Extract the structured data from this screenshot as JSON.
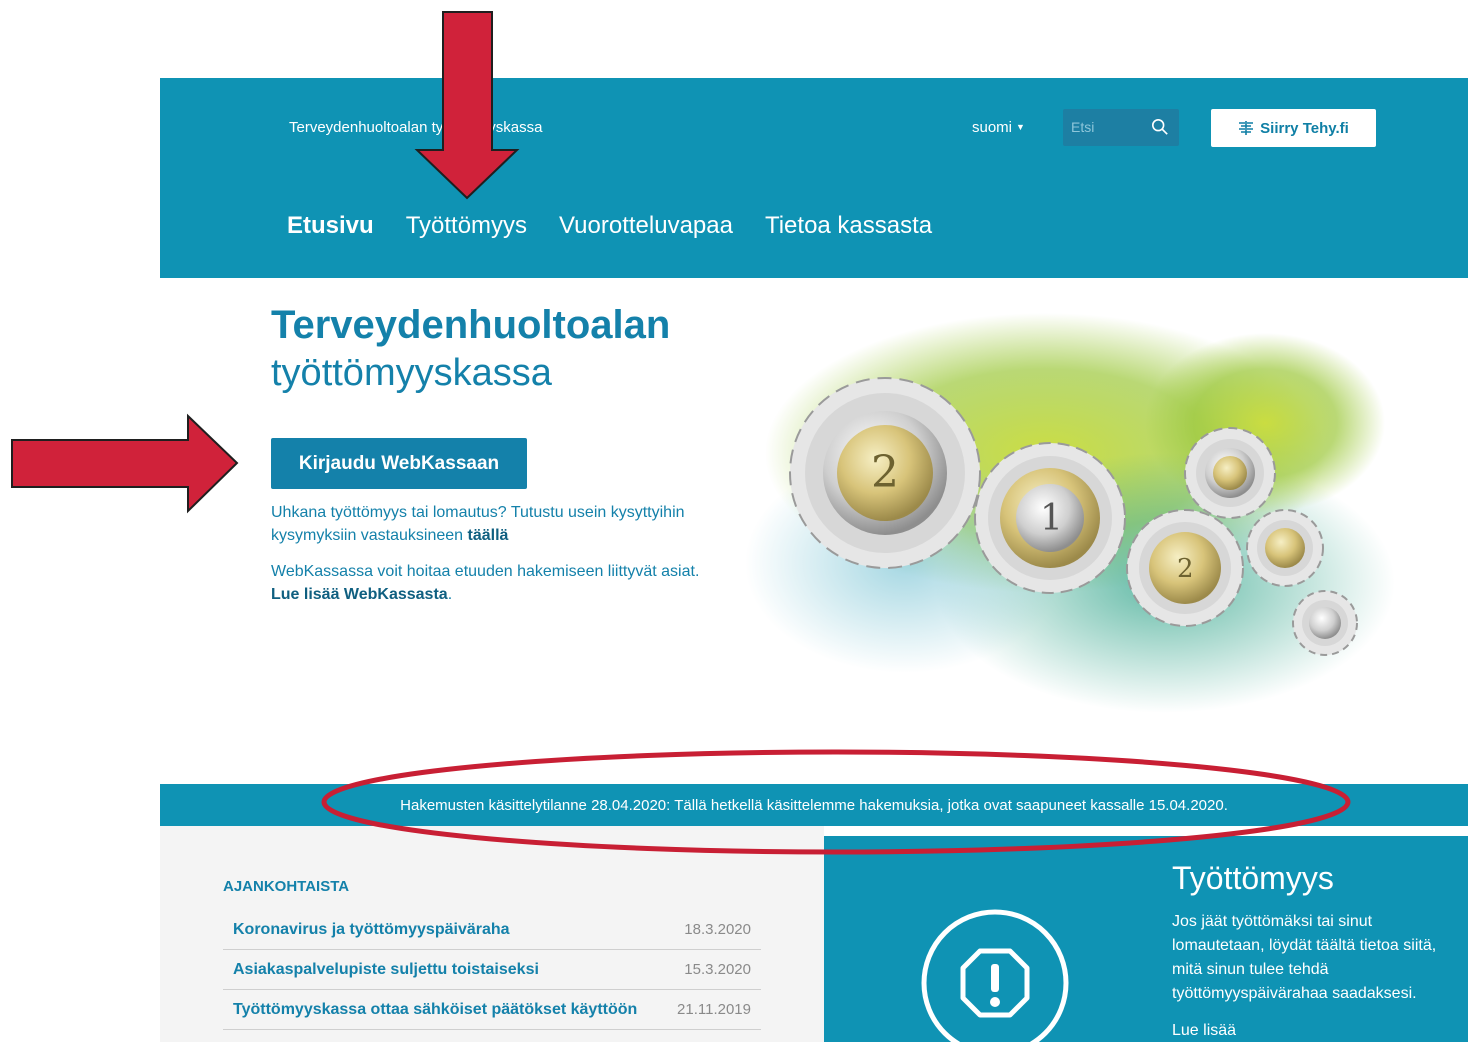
{
  "header": {
    "brand": "Terveydenhuoltoalan työttömyyskassa",
    "language": "suomi",
    "search_placeholder": "Etsi",
    "tehy_button": "Siirry Tehy.fi"
  },
  "nav": {
    "items": [
      "Etusivu",
      "Työttömyys",
      "Vuorotteluvapaa",
      "Tietoa kassasta"
    ]
  },
  "hero": {
    "title_bold": "Terveydenhuoltoalan",
    "title_light": "työttömyyskassa",
    "login_button": "Kirjaudu WebKassaan",
    "p1_text": "Uhkana työttömyys tai lomautus? Tutustu usein kysyttyihin kysymyksiin vastauksineen ",
    "p1_link": "täällä",
    "p2_text": "WebKassassa voit hoitaa etuuden hakemiseen liittyvät asiat. ",
    "p2_link": "Lue lisää WebKassasta",
    "p2_end": "."
  },
  "banner": {
    "text": "Hakemusten käsittelytilanne 28.04.2020: Tällä hetkellä käsittelemme hakemuksia, jotka ovat saapuneet kassalle 15.04.2020."
  },
  "news": {
    "heading": "AJANKOHTAISTA",
    "items": [
      {
        "title": "Koronavirus ja työttömyyspäiväraha",
        "date": "18.3.2020"
      },
      {
        "title": "Asiakaspalvelupiste suljettu toistaiseksi",
        "date": "15.3.2020"
      },
      {
        "title": "Työttömyyskassa ottaa sähköiset päätökset käyttöön",
        "date": "21.11.2019"
      }
    ]
  },
  "unemployment": {
    "title": "Työttömyys",
    "text": "Jos jäät työttömäksi tai sinut lomautetaan, löydät täältä tietoa siitä, mitä sinun tulee tehdä työttömyyspäivärahaa saadaksesi.",
    "more": "Lue lisää"
  },
  "icons": {
    "search": "search-icon",
    "tehy": "tehy-logo-icon",
    "caret": "caret-down-icon",
    "warning": "exclamation-octagon-icon"
  },
  "colors": {
    "primary": "#0f93b4",
    "text_blue": "#1481aa",
    "annotation_red": "#d0223a"
  }
}
